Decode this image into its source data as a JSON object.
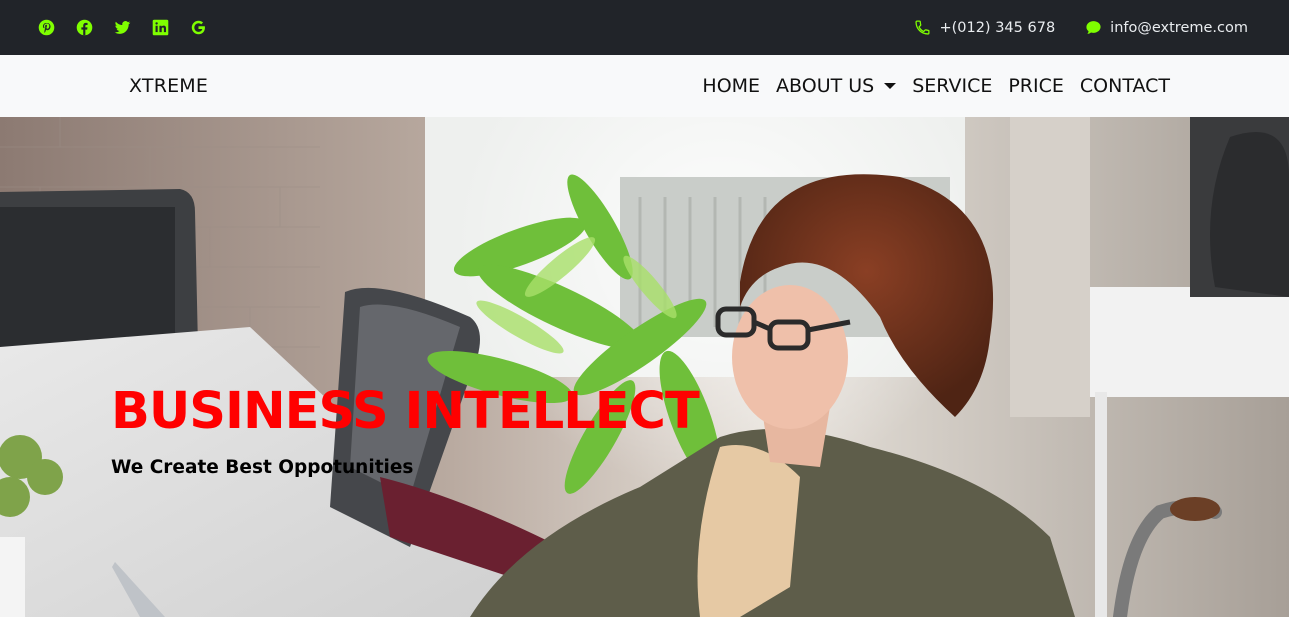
{
  "topbar": {
    "social": [
      {
        "icon": "pinterest-icon"
      },
      {
        "icon": "facebook-icon"
      },
      {
        "icon": "twitter-icon"
      },
      {
        "icon": "linkedin-icon"
      },
      {
        "icon": "google-icon"
      }
    ],
    "phone": "+(012) 345 678",
    "email": "info@extreme.com",
    "icon_color": "#7fff00"
  },
  "navbar": {
    "brand": "XTREME",
    "items": [
      {
        "label": "HOME"
      },
      {
        "label": "ABOUT US"
      },
      {
        "label": "SERVICE"
      },
      {
        "label": "PRICE"
      },
      {
        "label": "CONTACT"
      }
    ]
  },
  "hero": {
    "title": "BUSINESS INTELLECT",
    "subtitle": "We Create Best Oppotunities",
    "title_color": "#ff0000"
  }
}
